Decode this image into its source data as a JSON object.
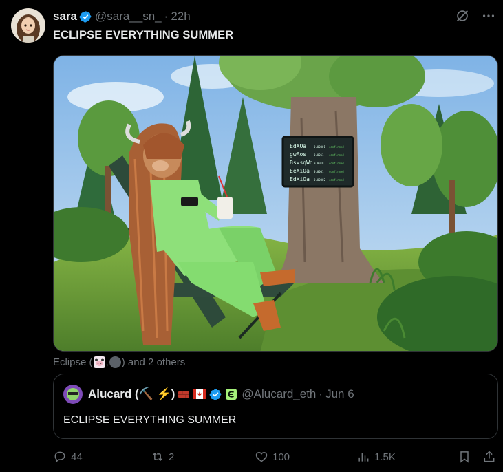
{
  "tweet": {
    "author_name": "sara",
    "handle": "@sara__sn_",
    "separator": "·",
    "time": "22h",
    "text": "ECLIPSE EVERYTHING SUMMER"
  },
  "media": {
    "screen_lines": [
      {
        "name": "EdXOa",
        "value": "0.00001",
        "status": "confirmed"
      },
      {
        "name": "gwAos",
        "value": "0.0011",
        "status": "confirmed"
      },
      {
        "name": "BsvsqWd",
        "value": "0.0018",
        "status": "confirmed"
      },
      {
        "name": "EeXiOa",
        "value": "0.0001",
        "status": "confirmed"
      },
      {
        "name": "EdXiOa",
        "value": "0.00002",
        "status": "confirmed"
      }
    ]
  },
  "liked_by": {
    "prefix": "Eclipse (",
    "separator": ",",
    "suffix": ") and 2 others"
  },
  "quote": {
    "author_name": "Alucard (⛏️ ⚡️)",
    "handle": "@Alucard_eth",
    "separator": "·",
    "date": "Jun 6",
    "text": "ECLIPSE EVERYTHING SUMMER"
  },
  "actions": {
    "replies": "44",
    "reposts": "2",
    "likes": "100",
    "views": "1.5K"
  },
  "colors": {
    "background": "#000000",
    "text": "#e7e9ea",
    "muted": "#71767b",
    "verified": "#1d9bf0",
    "border": "#2f3336"
  }
}
